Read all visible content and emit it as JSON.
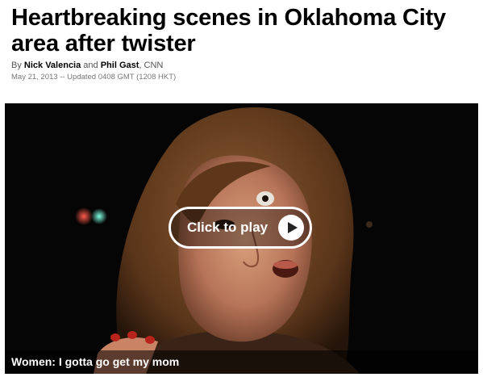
{
  "article": {
    "headline": "Heartbreaking scenes in Oklahoma City area after twister",
    "byline": {
      "prefix": "By",
      "author1": "Nick Valencia",
      "conjunction": "and",
      "author2": "Phil Gast",
      "source": ", CNN"
    },
    "timestamp": "May 21, 2013 -- Updated 0408 GMT (1208 HKT)"
  },
  "video": {
    "play_label": "Click to play",
    "play_icon": "play-icon",
    "caption": "Women: I gotta go get my mom",
    "colors": {
      "background": "#000000",
      "overlay_border": "#ffffff"
    }
  }
}
